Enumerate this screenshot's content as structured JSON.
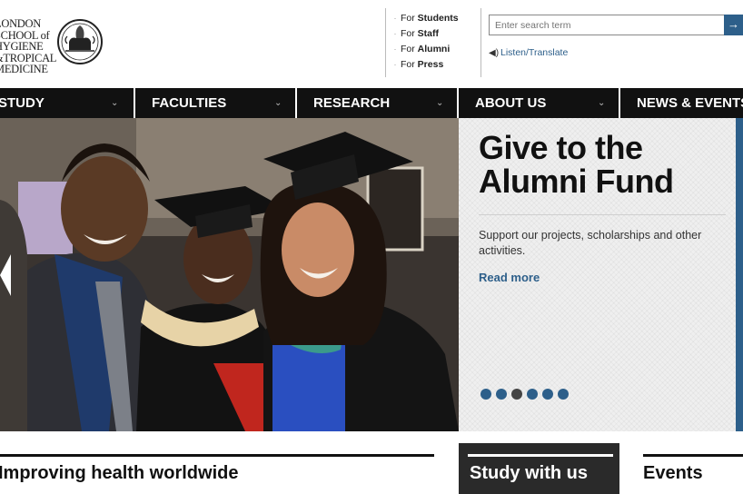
{
  "header": {
    "logo_lines": [
      "LONDON",
      "SCHOOL of",
      "HYGIENE",
      "&TROPICAL",
      "MEDICINE"
    ],
    "audience_links": [
      {
        "prefix": "For",
        "label": "Students"
      },
      {
        "prefix": "For",
        "label": "Staff"
      },
      {
        "prefix": "For",
        "label": "Alumni"
      },
      {
        "prefix": "For",
        "label": "Press"
      }
    ],
    "search": {
      "placeholder": "Enter search term",
      "button_icon": "arrow-right-icon",
      "button_glyph": "→"
    },
    "listen_label": "Listen/Translate"
  },
  "nav": {
    "items": [
      {
        "label": "STUDY"
      },
      {
        "label": "FACULTIES"
      },
      {
        "label": "RESEARCH"
      },
      {
        "label": "ABOUT US"
      },
      {
        "label": "NEWS & EVENTS"
      }
    ]
  },
  "hero": {
    "promo_title": "Give to the Alumni Fund",
    "promo_description": "Support our projects, scholarships and other activities.",
    "promo_link": "Read more",
    "slide_count": 6,
    "active_slide": 3
  },
  "sections": {
    "improving": "Improving health worldwide",
    "study": "Study with us",
    "events": "Events"
  },
  "colors": {
    "accent": "#2d5f8a",
    "nav_bg": "#111111",
    "study_box_bg": "#2a2a2a"
  }
}
